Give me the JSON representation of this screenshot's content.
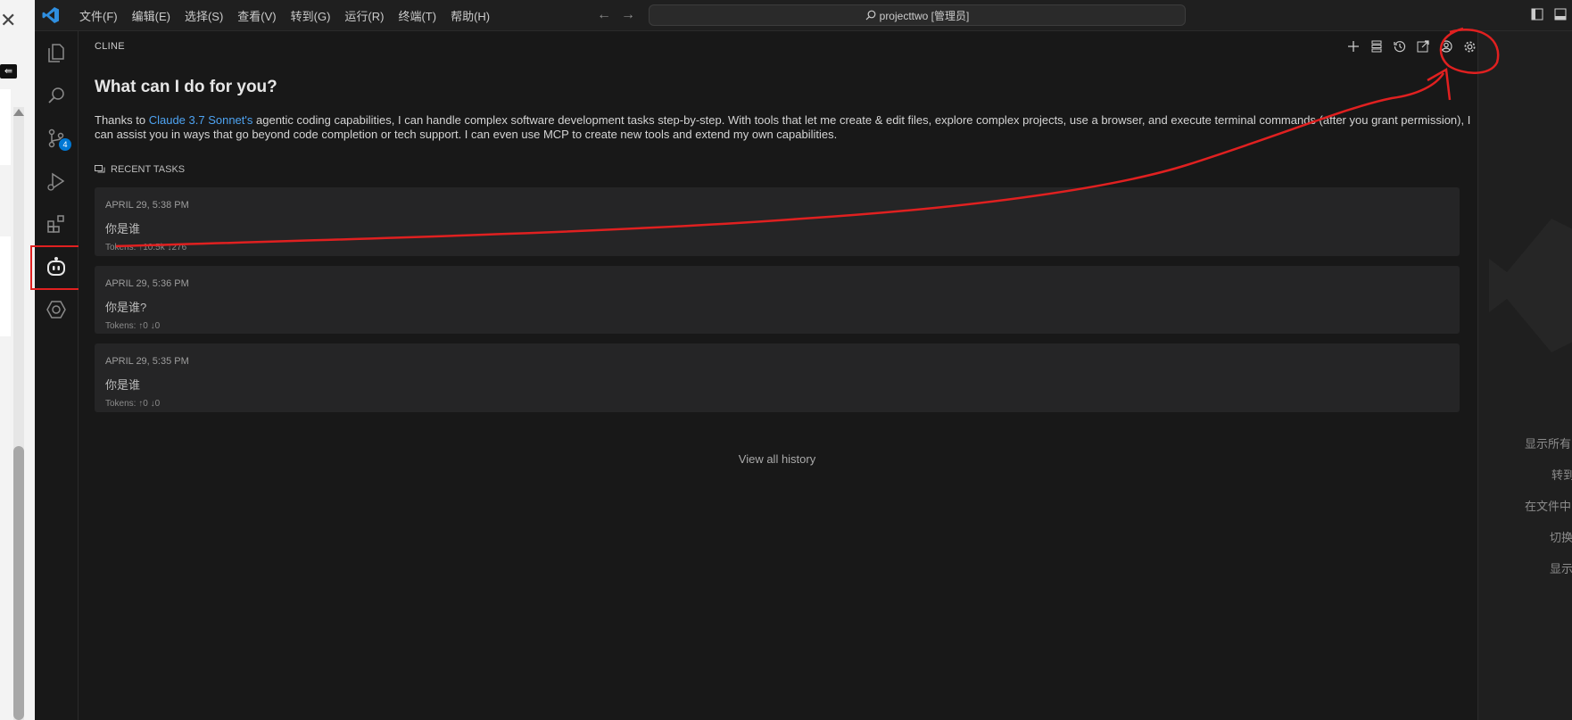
{
  "menu": [
    "文件(F)",
    "编辑(E)",
    "选择(S)",
    "查看(V)",
    "转到(G)",
    "运行(R)",
    "终端(T)",
    "帮助(H)"
  ],
  "search": {
    "text": "projecttwo [管理员]"
  },
  "activity": {
    "items": [
      "explorer-icon",
      "search-icon",
      "source-control-icon",
      "run-debug-icon",
      "extensions-icon",
      "cline-icon",
      "remote-icon"
    ],
    "badge": "4"
  },
  "panel": {
    "title": "CLINE",
    "actions": [
      "plus-icon",
      "list-icon",
      "history-icon",
      "popout-icon",
      "account-icon",
      "gear-icon"
    ]
  },
  "welcome": {
    "heading": "What can I do for you?",
    "intro_prefix": "Thanks to ",
    "intro_link": "Claude 3.7 Sonnet's",
    "intro_suffix": " agentic coding capabilities, I can handle complex software development tasks step-by-step. With tools that let me create & edit files, explore complex projects, use a browser, and execute terminal commands (after you grant permission), I can assist you in ways that go beyond code completion or tech support. I can even use MCP to create new tools and extend my own capabilities."
  },
  "recent": {
    "header": "RECENT TASKS",
    "tasks": [
      {
        "date": "APRIL 29, 5:38 PM",
        "query": "你是谁",
        "tokens": "Tokens: ↑10.5k ↓276"
      },
      {
        "date": "APRIL 29, 5:36 PM",
        "query": "你是谁?",
        "tokens": "Tokens: ↑0 ↓0"
      },
      {
        "date": "APRIL 29, 5:35 PM",
        "query": "你是谁",
        "tokens": "Tokens: ↑0 ↓0"
      }
    ],
    "view_all": "View all history"
  },
  "right_hints": [
    "显示所有",
    "转到",
    "在文件中",
    "切换",
    "显示"
  ],
  "colors": {
    "accent": "#0078d4",
    "link": "#4ea3f1",
    "annotation": "#e02020"
  }
}
